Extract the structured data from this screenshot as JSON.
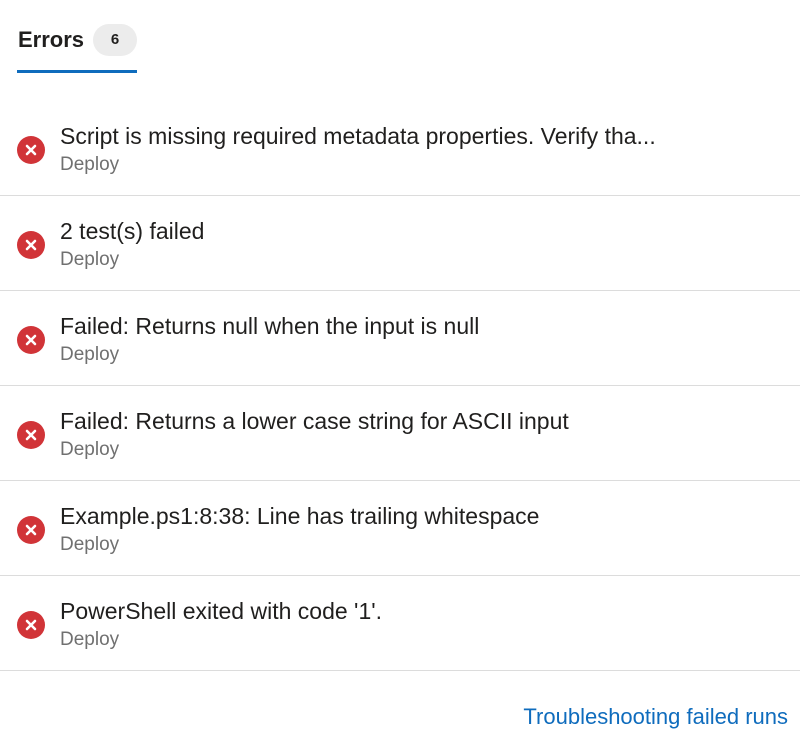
{
  "tab": {
    "label": "Errors",
    "count": "6",
    "accent_color": "#0f6cbd"
  },
  "errors": [
    {
      "icon": "error-circle-icon",
      "message": "Script is missing required metadata properties. Verify tha...",
      "source": "Deploy"
    },
    {
      "icon": "error-circle-icon",
      "message": "2 test(s) failed",
      "source": "Deploy"
    },
    {
      "icon": "error-circle-icon",
      "message": "Failed: Returns null when the input is null",
      "source": "Deploy"
    },
    {
      "icon": "error-circle-icon",
      "message": "Failed: Returns a lower case string for ASCII input",
      "source": "Deploy"
    },
    {
      "icon": "error-circle-icon",
      "message": "Example.ps1:8:38: Line has trailing whitespace",
      "source": "Deploy"
    },
    {
      "icon": "error-circle-icon",
      "message": "PowerShell exited with code '1'.",
      "source": "Deploy"
    }
  ],
  "error_color": "#d13438",
  "footer": {
    "link_label": "Troubleshooting failed runs"
  }
}
